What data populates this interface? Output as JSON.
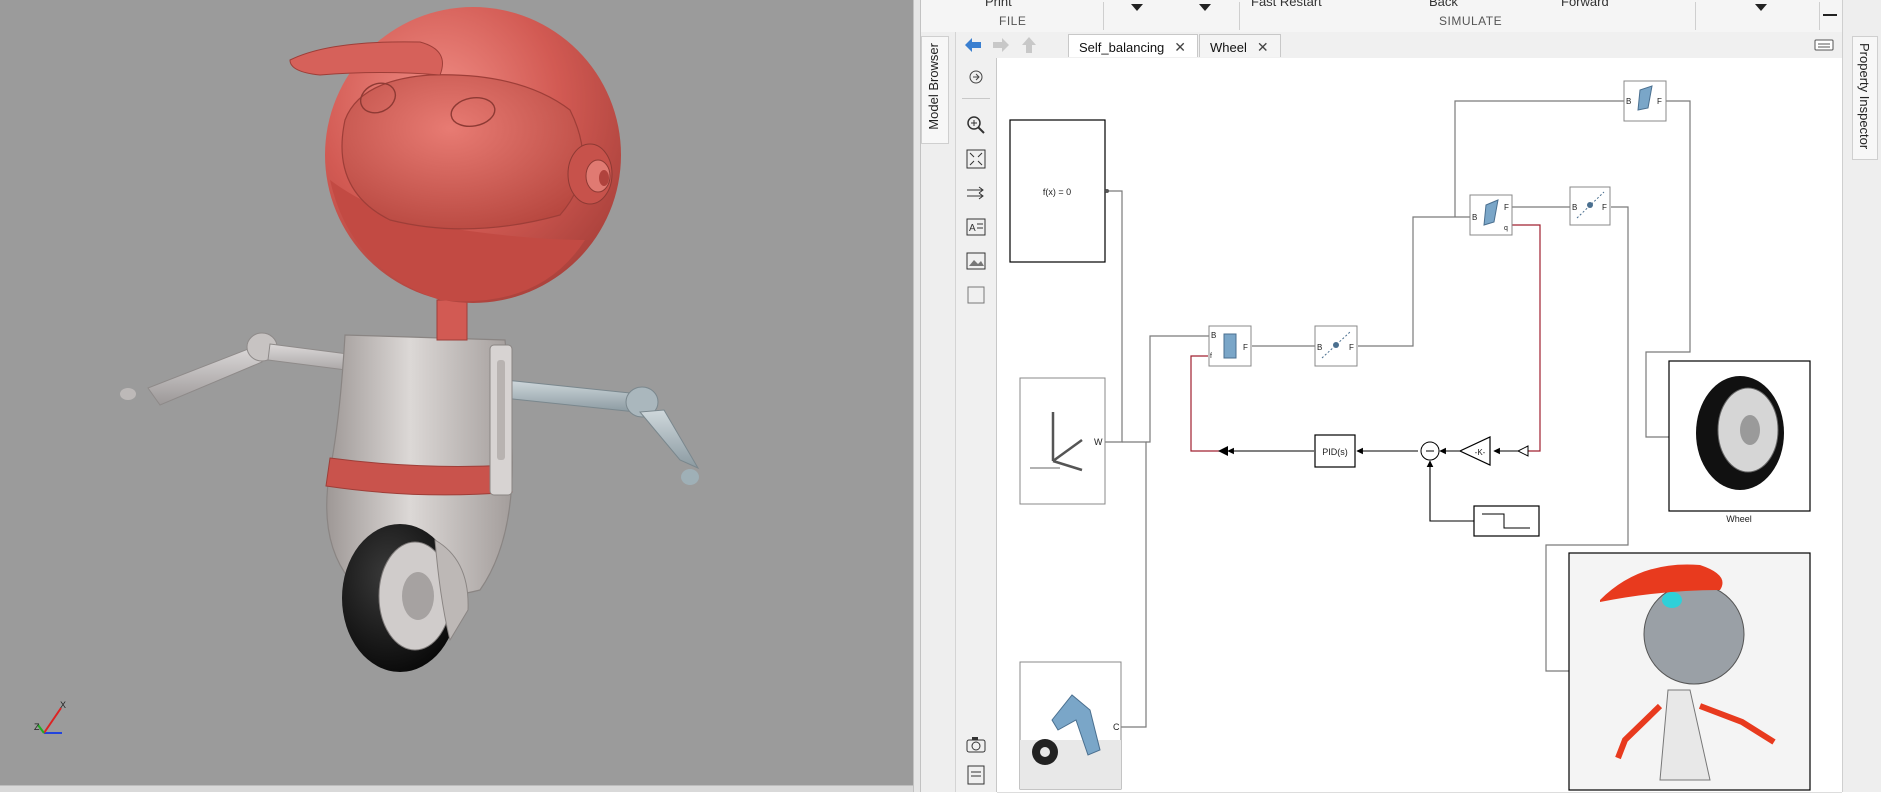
{
  "toolstrip": {
    "file_label": "FILE",
    "simulate_label": "SIMULATE",
    "print_label": "Print",
    "fast_restart_label": "Fast Restart",
    "back_label": "Back",
    "forward_label": "Forward"
  },
  "panels": {
    "model_browser": "Model Browser",
    "property_inspector": "Property Inspector"
  },
  "tabs": [
    {
      "label": "Self_balancing",
      "active": true
    },
    {
      "label": "Wheel",
      "active": false
    }
  ],
  "blocks": {
    "solver_label": "f(x) = 0",
    "pid_label": "PID(s)",
    "gain_label": "-K-",
    "wheel_caption": "Wheel",
    "world_port": "W",
    "config_port": "C",
    "port_b": "B",
    "port_f": "F",
    "port_q": "q",
    "port_f_small": "f"
  },
  "axis_triad": {
    "x": "X",
    "y": "Y",
    "z": "Z"
  },
  "colors": {
    "viewport_bg": "#9b9b9b",
    "robot_red": "#d9605b",
    "robot_gray": "#c9c4c2",
    "signal_line": "#000000",
    "physical_line": "#7a7a7a",
    "constraint_line": "#a02030"
  }
}
